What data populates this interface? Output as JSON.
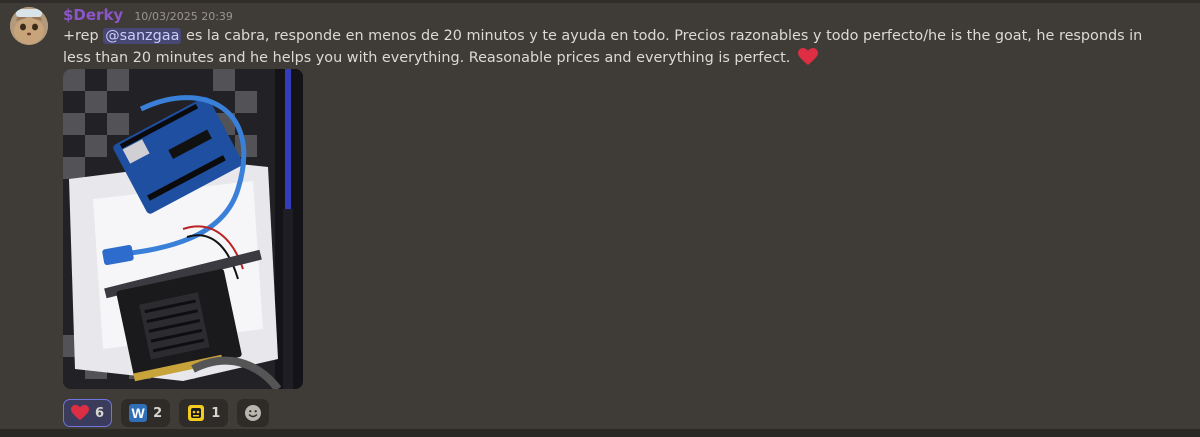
{
  "message": {
    "username": "$Derky",
    "timestamp": "10/03/2025 20:39",
    "text_prefix": "+rep ",
    "mention": "@sanzgaa",
    "text_body": " es la cabra, responde en menos de 20 minutos y te ayuda en todo. Precios razonables y todo perfecto/he is the goat, he responds in less than 20 minutes and he helps you with everything. Reasonable prices and everything is perfect.",
    "trailing_emoji": "heart-emoji"
  },
  "reactions": [
    {
      "emoji": "heart-emoji",
      "count": "6",
      "active": true
    },
    {
      "emoji": "w-letter-emoji",
      "label": "W",
      "count": "2",
      "active": false
    },
    {
      "emoji": "yellow-face-emoji",
      "count": "1",
      "active": false
    }
  ],
  "add_reaction": {
    "icon": "smiley-icon"
  },
  "colors": {
    "background": "#3f3b36",
    "username": "#8b56c8",
    "mention_bg": "#4e5394",
    "active_reaction_border": "#6e74e0"
  }
}
